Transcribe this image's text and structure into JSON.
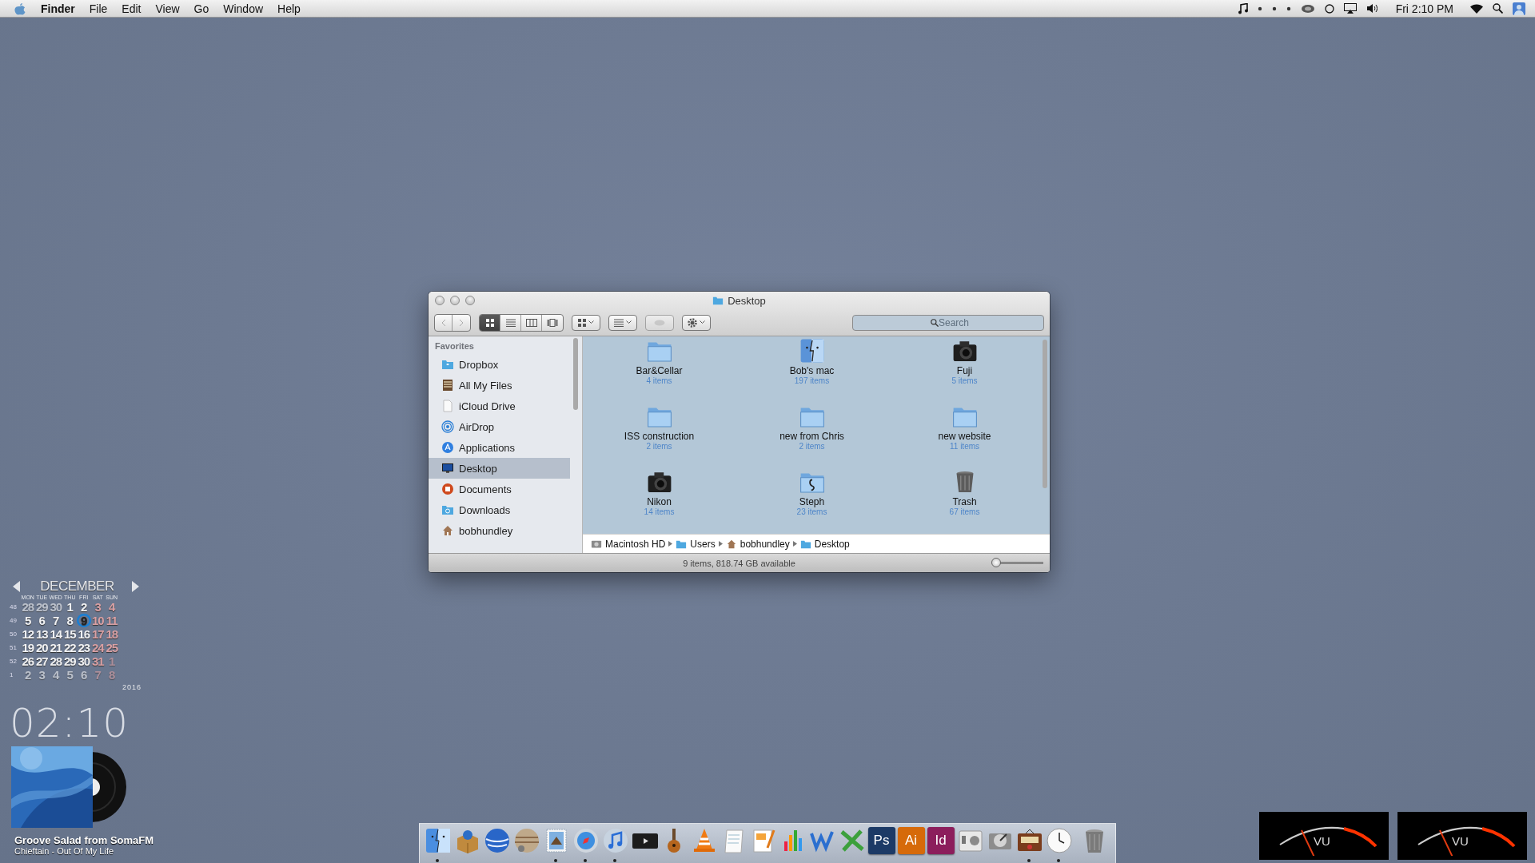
{
  "menu_bar": {
    "app": "Finder",
    "menus": [
      "File",
      "Edit",
      "View",
      "Go",
      "Window",
      "Help"
    ],
    "clock": "Fri 2:10 PM"
  },
  "finder": {
    "title": "Desktop",
    "view_modes": [
      {
        "kind": "icons",
        "selected": true
      },
      {
        "kind": "list",
        "selected": false
      },
      {
        "kind": "columns",
        "selected": false
      },
      {
        "kind": "coverflow",
        "selected": false
      }
    ],
    "quick_look": {
      "disabled": true
    },
    "search": {
      "placeholder": "Search"
    },
    "sidebar": {
      "heading": "Favorites",
      "items": [
        {
          "label": "Dropbox",
          "kind": "dropbox",
          "selected": false
        },
        {
          "label": "All My Files",
          "kind": "files",
          "selected": false
        },
        {
          "label": "iCloud Drive",
          "kind": "page",
          "selected": false
        },
        {
          "label": "AirDrop",
          "kind": "airdrop",
          "selected": false
        },
        {
          "label": "Applications",
          "kind": "apps",
          "selected": false
        },
        {
          "label": "Desktop",
          "kind": "desktop",
          "selected": true
        },
        {
          "label": "Documents",
          "kind": "documents",
          "selected": false
        },
        {
          "label": "Downloads",
          "kind": "downloads",
          "selected": false
        },
        {
          "label": "bobhundley",
          "kind": "home",
          "selected": false
        }
      ]
    },
    "files": [
      {
        "name": "Bar&Cellar",
        "count": "4 items",
        "kind": "folder"
      },
      {
        "name": "Bob's mac",
        "count": "197 items",
        "kind": "mac"
      },
      {
        "name": "Fuji",
        "count": "5 items",
        "kind": "camera"
      },
      {
        "name": "ISS construction",
        "count": "2 items",
        "kind": "folder"
      },
      {
        "name": "new from Chris",
        "count": "2 items",
        "kind": "folder"
      },
      {
        "name": "new website",
        "count": "11 items",
        "kind": "folder"
      },
      {
        "name": "Nikon",
        "count": "14 items",
        "kind": "camera"
      },
      {
        "name": "Steph",
        "count": "23 items",
        "kind": "music"
      },
      {
        "name": "Trash",
        "count": "67 items",
        "kind": "trash"
      }
    ],
    "path": [
      {
        "label": "Macintosh HD",
        "kind": "disk"
      },
      {
        "label": "Users",
        "kind": "folder"
      },
      {
        "label": "bobhundley",
        "kind": "home"
      },
      {
        "label": "Desktop",
        "kind": "folder"
      }
    ],
    "status": "9 items, 818.74 GB available",
    "icon_size": {
      "level": 0.08
    }
  },
  "calendar": {
    "month": "DECEMBER",
    "weekdays": [
      "MON",
      "TUE",
      "WED",
      "THU",
      "FRI",
      "SAT",
      "SUN"
    ],
    "weeks": [
      {
        "number": "48",
        "days": [
          {
            "d": "28",
            "muted": true,
            "today": false
          },
          {
            "d": "29",
            "muted": true,
            "today": false
          },
          {
            "d": "30",
            "muted": true,
            "today": false
          },
          {
            "d": "1",
            "muted": false,
            "today": false
          },
          {
            "d": "2",
            "muted": false,
            "today": false
          },
          {
            "d": "3",
            "muted": false,
            "today": false
          },
          {
            "d": "4",
            "muted": false,
            "today": false
          }
        ]
      },
      {
        "number": "49",
        "days": [
          {
            "d": "5",
            "muted": false,
            "today": false
          },
          {
            "d": "6",
            "muted": false,
            "today": false
          },
          {
            "d": "7",
            "muted": false,
            "today": false
          },
          {
            "d": "8",
            "muted": false,
            "today": false
          },
          {
            "d": "9",
            "muted": false,
            "today": true
          },
          {
            "d": "10",
            "muted": false,
            "today": false
          },
          {
            "d": "11",
            "muted": false,
            "today": false
          }
        ]
      },
      {
        "number": "50",
        "days": [
          {
            "d": "12",
            "muted": false,
            "today": false
          },
          {
            "d": "13",
            "muted": false,
            "today": false
          },
          {
            "d": "14",
            "muted": false,
            "today": false
          },
          {
            "d": "15",
            "muted": false,
            "today": false
          },
          {
            "d": "16",
            "muted": false,
            "today": false
          },
          {
            "d": "17",
            "muted": false,
            "today": false
          },
          {
            "d": "18",
            "muted": false,
            "today": false
          }
        ]
      },
      {
        "number": "51",
        "days": [
          {
            "d": "19",
            "muted": false,
            "today": false
          },
          {
            "d": "20",
            "muted": false,
            "today": false
          },
          {
            "d": "21",
            "muted": false,
            "today": false
          },
          {
            "d": "22",
            "muted": false,
            "today": false
          },
          {
            "d": "23",
            "muted": false,
            "today": false
          },
          {
            "d": "24",
            "muted": false,
            "today": false
          },
          {
            "d": "25",
            "muted": false,
            "today": false
          }
        ]
      },
      {
        "number": "52",
        "days": [
          {
            "d": "26",
            "muted": false,
            "today": false
          },
          {
            "d": "27",
            "muted": false,
            "today": false
          },
          {
            "d": "28",
            "muted": false,
            "today": false
          },
          {
            "d": "29",
            "muted": false,
            "today": false
          },
          {
            "d": "30",
            "muted": false,
            "today": false
          },
          {
            "d": "31",
            "muted": false,
            "today": false
          },
          {
            "d": "1",
            "muted": true,
            "today": false
          }
        ]
      },
      {
        "number": "1",
        "days": [
          {
            "d": "2",
            "muted": true,
            "today": false
          },
          {
            "d": "3",
            "muted": true,
            "today": false
          },
          {
            "d": "4",
            "muted": true,
            "today": false
          },
          {
            "d": "5",
            "muted": true,
            "today": false
          },
          {
            "d": "6",
            "muted": true,
            "today": false
          },
          {
            "d": "7",
            "muted": true,
            "today": false
          },
          {
            "d": "8",
            "muted": true,
            "today": false
          }
        ]
      }
    ],
    "year": "2016"
  },
  "clock": "02:10",
  "now_playing": {
    "station": "Groove Salad from SomaFM",
    "track": "Chieftain - Out Of My Life"
  },
  "dock": [
    {
      "kind": "finder",
      "running": true
    },
    {
      "kind": "package",
      "running": false
    },
    {
      "kind": "globe",
      "running": false
    },
    {
      "kind": "planet",
      "running": false
    },
    {
      "kind": "mail",
      "running": true
    },
    {
      "kind": "compass",
      "running": true
    },
    {
      "kind": "music",
      "running": true
    },
    {
      "kind": "video",
      "running": false
    },
    {
      "kind": "guitar",
      "running": false
    },
    {
      "kind": "cone",
      "running": false
    },
    {
      "kind": "notepad",
      "running": false
    },
    {
      "kind": "pages",
      "running": false
    },
    {
      "kind": "chart",
      "running": false
    },
    {
      "kind": "wave",
      "running": false
    },
    {
      "kind": "cross",
      "running": false
    },
    {
      "kind": "tile",
      "label": "Ps",
      "color": "#1c3a66",
      "running": false
    },
    {
      "kind": "tile",
      "label": "Ai",
      "color": "#d66a0a",
      "running": false
    },
    {
      "kind": "tile",
      "label": "Id",
      "color": "#8c1e5c",
      "running": false
    },
    {
      "kind": "switch",
      "running": false
    },
    {
      "kind": "disk",
      "running": false
    },
    {
      "kind": "radio",
      "running": true
    },
    {
      "kind": "clock",
      "running": true
    },
    {
      "kind": "trash",
      "running": false
    }
  ],
  "vu_meters": [
    {
      "label": "VU"
    },
    {
      "label": "VU"
    }
  ]
}
